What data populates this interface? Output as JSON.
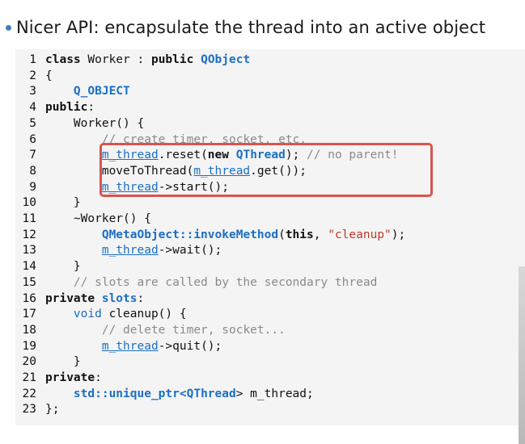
{
  "slide": {
    "bullet": "Nicer API: encapsulate the thread into an active object",
    "highlight_color": "#d9534f",
    "bullet_color": "#3f7ec2"
  },
  "code": {
    "lines": [
      {
        "n": "1",
        "tokens": [
          {
            "t": "class",
            "c": "kw"
          },
          {
            "t": " Worker : ",
            "c": "plain"
          },
          {
            "t": "public",
            "c": "kw"
          },
          {
            "t": " ",
            "c": "plain"
          },
          {
            "t": "QObject",
            "c": "ty"
          }
        ]
      },
      {
        "n": "2",
        "tokens": [
          {
            "t": "{",
            "c": "plain"
          }
        ]
      },
      {
        "n": "3",
        "tokens": [
          {
            "t": "    ",
            "c": "plain"
          },
          {
            "t": "Q_OBJECT",
            "c": "ty"
          }
        ]
      },
      {
        "n": "4",
        "tokens": [
          {
            "t": "public",
            "c": "kw"
          },
          {
            "t": ":",
            "c": "plain"
          }
        ]
      },
      {
        "n": "5",
        "tokens": [
          {
            "t": "    Worker() {",
            "c": "plain"
          }
        ]
      },
      {
        "n": "6",
        "tokens": [
          {
            "t": "        ",
            "c": "plain"
          },
          {
            "t": "// create timer, socket, etc.",
            "c": "cm"
          }
        ]
      },
      {
        "n": "7",
        "tokens": [
          {
            "t": "        ",
            "c": "plain"
          },
          {
            "t": "m_thread",
            "c": "mem"
          },
          {
            "t": ".reset(",
            "c": "plain"
          },
          {
            "t": "new",
            "c": "kw"
          },
          {
            "t": " ",
            "c": "plain"
          },
          {
            "t": "QThread",
            "c": "ty"
          },
          {
            "t": "); ",
            "c": "plain"
          },
          {
            "t": "// no parent!",
            "c": "cm"
          }
        ]
      },
      {
        "n": "8",
        "tokens": [
          {
            "t": "        moveToThread(",
            "c": "plain"
          },
          {
            "t": "m_thread",
            "c": "mem"
          },
          {
            "t": ".get());",
            "c": "plain"
          }
        ]
      },
      {
        "n": "9",
        "tokens": [
          {
            "t": "        ",
            "c": "plain"
          },
          {
            "t": "m_thread",
            "c": "mem"
          },
          {
            "t": "->start();",
            "c": "plain"
          }
        ]
      },
      {
        "n": "10",
        "tokens": [
          {
            "t": "    }",
            "c": "plain"
          }
        ]
      },
      {
        "n": "11",
        "tokens": [
          {
            "t": "    ~Worker() {",
            "c": "plain"
          }
        ]
      },
      {
        "n": "12",
        "tokens": [
          {
            "t": "        ",
            "c": "plain"
          },
          {
            "t": "QMetaObject::invokeMethod",
            "c": "ty"
          },
          {
            "t": "(",
            "c": "plain"
          },
          {
            "t": "this",
            "c": "kw"
          },
          {
            "t": ", ",
            "c": "plain"
          },
          {
            "t": "\"cleanup\"",
            "c": "st"
          },
          {
            "t": ");",
            "c": "plain"
          }
        ]
      },
      {
        "n": "13",
        "tokens": [
          {
            "t": "        ",
            "c": "plain"
          },
          {
            "t": "m_thread",
            "c": "mem"
          },
          {
            "t": "->wait();",
            "c": "plain"
          }
        ]
      },
      {
        "n": "14",
        "tokens": [
          {
            "t": "    }",
            "c": "plain"
          }
        ]
      },
      {
        "n": "15",
        "tokens": [
          {
            "t": "    ",
            "c": "plain"
          },
          {
            "t": "// slots are called by the secondary thread",
            "c": "cm"
          }
        ]
      },
      {
        "n": "16",
        "tokens": [
          {
            "t": "private",
            "c": "kw"
          },
          {
            "t": " ",
            "c": "plain"
          },
          {
            "t": "slots",
            "c": "cmk"
          },
          {
            "t": ":",
            "c": "plain"
          }
        ]
      },
      {
        "n": "17",
        "tokens": [
          {
            "t": "    ",
            "c": "plain"
          },
          {
            "t": "void",
            "c": "vd"
          },
          {
            "t": " cleanup() {",
            "c": "plain"
          }
        ]
      },
      {
        "n": "18",
        "tokens": [
          {
            "t": "        ",
            "c": "plain"
          },
          {
            "t": "// delete timer, socket...",
            "c": "cm"
          }
        ]
      },
      {
        "n": "19",
        "tokens": [
          {
            "t": "        ",
            "c": "plain"
          },
          {
            "t": "m_thread",
            "c": "mem"
          },
          {
            "t": "->quit();",
            "c": "plain"
          }
        ]
      },
      {
        "n": "20",
        "tokens": [
          {
            "t": "    }",
            "c": "plain"
          }
        ]
      },
      {
        "n": "21",
        "tokens": [
          {
            "t": "private",
            "c": "kw"
          },
          {
            "t": ":",
            "c": "plain"
          }
        ]
      },
      {
        "n": "22",
        "tokens": [
          {
            "t": "    ",
            "c": "plain"
          },
          {
            "t": "std::unique_ptr<",
            "c": "ty"
          },
          {
            "t": "QThread",
            "c": "ty"
          },
          {
            "t": "> m_thread;",
            "c": "plain"
          }
        ]
      },
      {
        "n": "23",
        "tokens": [
          {
            "t": "};",
            "c": "plain"
          }
        ]
      }
    ]
  }
}
